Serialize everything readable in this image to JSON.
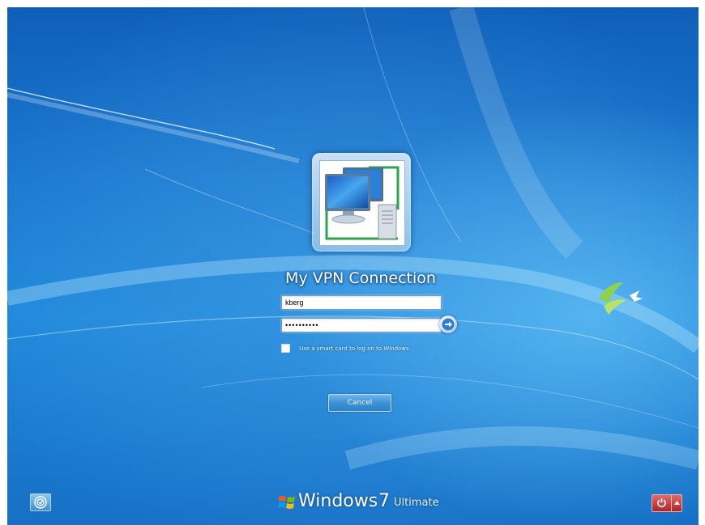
{
  "login": {
    "title": "My VPN Connection",
    "username_value": "kberg",
    "password_value": "••••••••••",
    "smartcard_label": "Use a smart card to log on to Windows",
    "smartcard_checked": false,
    "cancel_label": "Cancel"
  },
  "brand": {
    "windows": "Windows",
    "version": "7",
    "edition": "Ultimate"
  },
  "icons": {
    "profile": "network-computers-icon",
    "submit": "arrow-right-icon",
    "ease_of_access": "ease-of-access-icon",
    "power": "power-icon",
    "power_options": "triangle-up-icon",
    "brand_logo": "windows-flag-icon"
  },
  "colors": {
    "background": "#1a78cf",
    "power_button": "#c43030",
    "tile_border_green": "#2ea44f"
  }
}
